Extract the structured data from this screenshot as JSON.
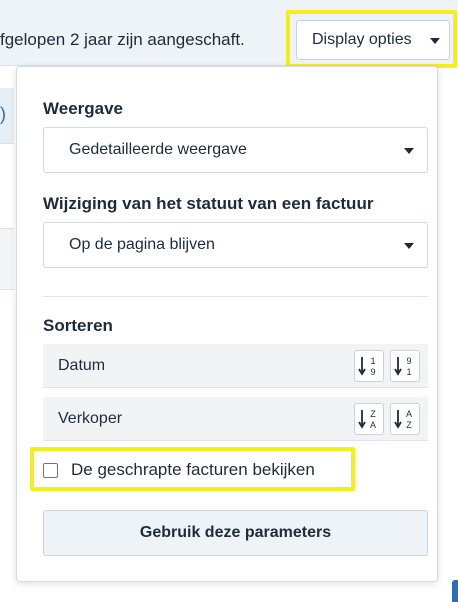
{
  "header": {
    "message": "fgelopen 2 jaar zijn aangeschaft.",
    "display_button_label": "Display opties",
    "display_button_icon": "chevron-down-icon"
  },
  "background": {
    "left_row_text": ")"
  },
  "panel": {
    "view": {
      "label": "Weergave",
      "selected": "Gedetailleerde weergave",
      "icon": "chevron-down-icon"
    },
    "status_change": {
      "label": "Wijziging van het statuut van een factuur",
      "selected": "Op de pagina blijven",
      "icon": "chevron-down-icon"
    },
    "sort": {
      "label": "Sorteren",
      "rows": [
        {
          "label": "Datum",
          "asc_icon": "sort-numeric-ascending-icon",
          "desc_icon": "sort-numeric-descending-icon"
        },
        {
          "label": "Verkoper",
          "asc_icon": "sort-alpha-ascending-icon",
          "desc_icon": "sort-alpha-descending-icon"
        }
      ]
    },
    "show_deleted": {
      "label": "De geschrapte facturen bekijken",
      "checked": false
    },
    "apply_button_label": "Gebruik deze parameters"
  },
  "colors": {
    "highlight": "#f5ee1d",
    "header_bg": "#eef3f8",
    "accent": "#2a6fb5"
  }
}
